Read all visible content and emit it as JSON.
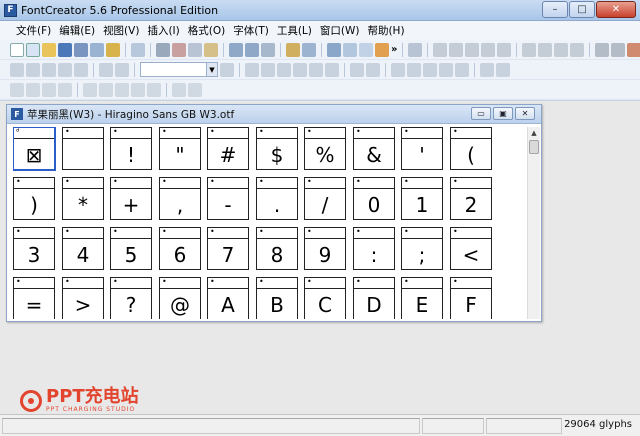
{
  "window": {
    "title": "FontCreator 5.6 Professional Edition",
    "minimize": "–",
    "maximize": "□",
    "close": "✕"
  },
  "menu": [
    "文件(F)",
    "编辑(E)",
    "视图(V)",
    "插入(I)",
    "格式(O)",
    "字体(T)",
    "工具(L)",
    "窗口(W)",
    "帮助(H)"
  ],
  "toolbar": {
    "overflow": "»"
  },
  "font_window": {
    "title": "苹果丽黑(W3) - Hiragino Sans GB W3.otf",
    "min": "▭",
    "max": "▣",
    "close": "✕"
  },
  "glyphs": [
    [
      "⊠",
      "",
      "!",
      "\"",
      "#",
      "$",
      "%",
      "&",
      "'",
      "("
    ],
    [
      ")",
      "*",
      "+",
      ",",
      "-",
      ".",
      "/",
      "0",
      "1",
      "2"
    ],
    [
      "3",
      "4",
      "5",
      "6",
      "7",
      "8",
      "9",
      ":",
      ";",
      "<"
    ],
    [
      "=",
      ">",
      "?",
      "@",
      "A",
      "B",
      "C",
      "D",
      "E",
      "F"
    ]
  ],
  "first_cell_marker": "ᵈ",
  "cell_marker": "•",
  "status": {
    "glyph_count": "29064 glyphs"
  },
  "watermark": {
    "main": "PPT充电站",
    "sub": "PPT CHARGING STUDIO"
  }
}
